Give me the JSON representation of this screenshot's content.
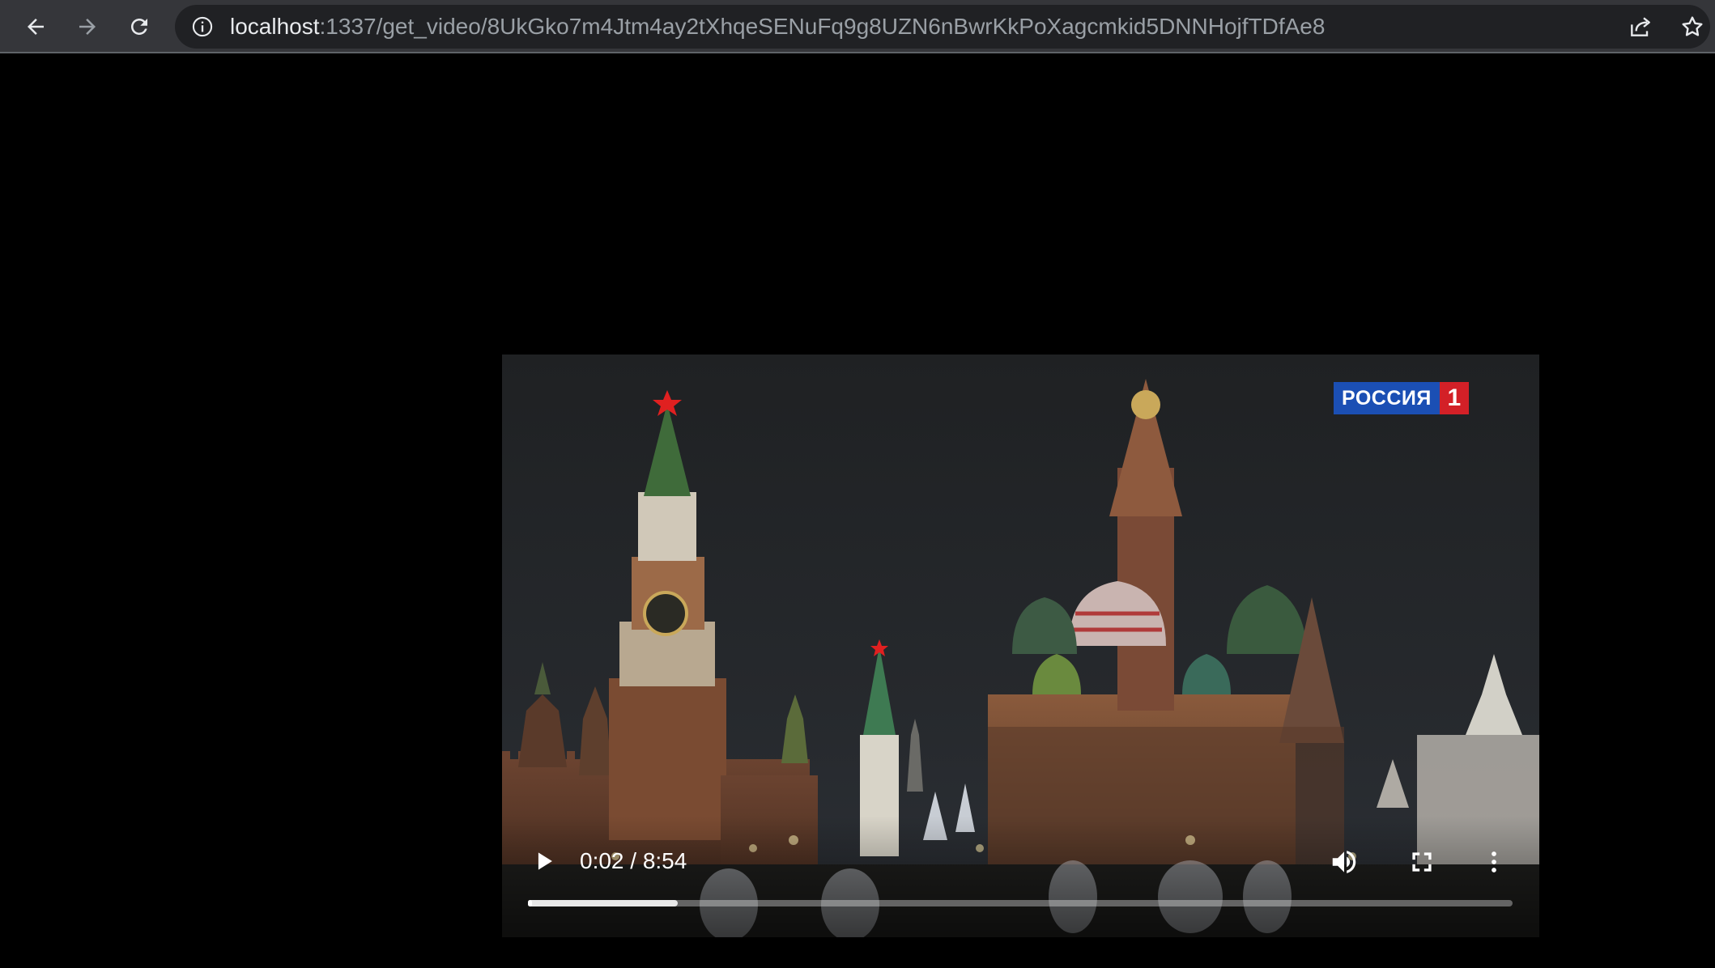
{
  "browser": {
    "url_host": "localhost",
    "url_path": ":1337/get_video/8UkGko7m4Jtm4ay2tXhqeSENuFq9g8UZN6nBwrKkPoXagcmkid5DNNHojfTDfAe8",
    "icons": {
      "back": "arrow-left-icon",
      "forward": "arrow-right-icon",
      "reload": "reload-icon",
      "site_info": "info-icon",
      "share": "share-icon",
      "bookmark": "star-icon"
    }
  },
  "video": {
    "channel_logo_text": "РОССИЯ",
    "channel_logo_number": "1",
    "time_display": "0:02 / 8:54",
    "progress_played": 0.004,
    "progress_buffered": 0.152,
    "colors": {
      "logo_blue": "#1b4fb4",
      "logo_red": "#d32027"
    }
  }
}
